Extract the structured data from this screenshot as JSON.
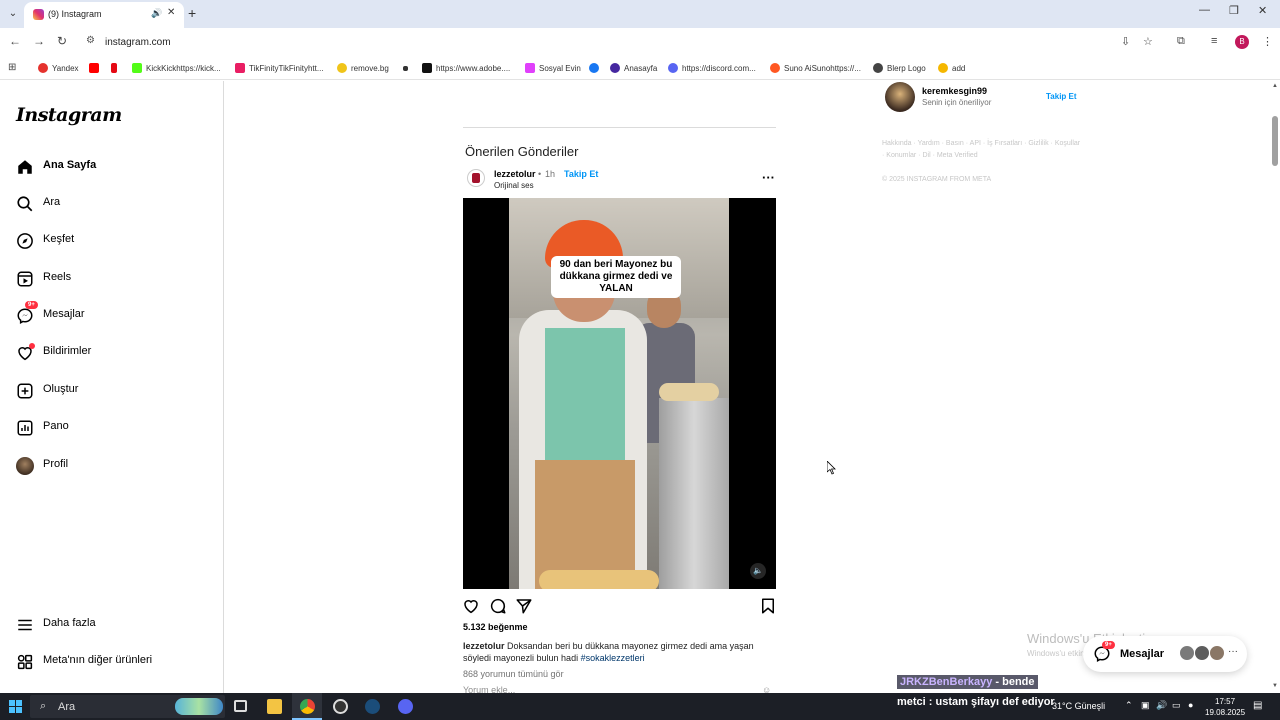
{
  "browser": {
    "tab_title": "(9) Instagram",
    "url": "instagram.com",
    "profile_letter": "B",
    "bookmarks": [
      {
        "label": "Yandex",
        "color": "#e5322d"
      },
      {
        "label": "",
        "color": "#ff0000"
      },
      {
        "label": "",
        "color": "#e50914"
      },
      {
        "label": "KickKickhttps://kick...",
        "color": "#53fc18"
      },
      {
        "label": "TikFinityTikFinityhtt...",
        "color": "#e91e63"
      },
      {
        "label": "remove.bg",
        "color": "#f0c419"
      },
      {
        "label": "",
        "color": "#333333"
      },
      {
        "label": "https://www.adobe....",
        "color": "#111111"
      },
      {
        "label": "Sosyal Evin",
        "color": "#e040fb"
      },
      {
        "label": "",
        "color": "#1877f2"
      },
      {
        "label": "Anasayfa",
        "color": "#4527a0"
      },
      {
        "label": "https://discord.com...",
        "color": "#5865f2"
      },
      {
        "label": "Suno AiSunohttps://...",
        "color": "#ff5722"
      },
      {
        "label": "Blerp Logo",
        "color": "#444444"
      },
      {
        "label": "add",
        "color": "#f5b700"
      }
    ]
  },
  "sidebar": {
    "logo": "Instagram",
    "items": [
      {
        "label": "Ana Sayfa",
        "icon": "home-icon"
      },
      {
        "label": "Ara",
        "icon": "search-icon"
      },
      {
        "label": "Keşfet",
        "icon": "compass-icon"
      },
      {
        "label": "Reels",
        "icon": "reels-icon"
      },
      {
        "label": "Mesajlar",
        "icon": "messenger-icon",
        "badge": "9+"
      },
      {
        "label": "Bildirimler",
        "icon": "heart-icon"
      },
      {
        "label": "Oluştur",
        "icon": "plus-square-icon"
      },
      {
        "label": "Pano",
        "icon": "dashboard-icon"
      },
      {
        "label": "Profil",
        "icon": "profile-avatar"
      }
    ],
    "more": "Daha fazla",
    "meta": "Meta'nın diğer ürünleri"
  },
  "feed": {
    "section_title": "Önerilen Gönderiler",
    "post": {
      "username": "lezzetolur",
      "separator": "•",
      "time": "1h",
      "follow": "Takip Et",
      "audio": "Orijinal ses",
      "overlay_text": "90 dan beri Mayonez bu dükkana girmez dedi ve YALAN",
      "likes": "5.132 beğenme",
      "caption_user": "lezzetolur",
      "caption": "Doksandan beri bu dükkana mayonez girmez dedi ama yaşan söyledi mayonezli bulun hadi",
      "hashtag": "#sokaklezzetleri",
      "view_comments": "868 yorumun tümünü gör",
      "add_comment": "Yorum ekle..."
    }
  },
  "right": {
    "suggestion": {
      "username": "keremkesgin99",
      "subtitle": "Senin için öneriliyor",
      "follow": "Takip Et"
    },
    "footer": "Hakkında · Yardım · Basın · API · İş Fırsatları · Gizlilik · Koşullar · Konumlar · Dil · Meta Verified",
    "copyright": "© 2025 INSTAGRAM FROM META"
  },
  "overlay": {
    "activate_title": "Windows'u Etkinleştir",
    "activate_sub": "Windows'u etkinleştirmek için Ayarlar'a gidin.",
    "messages_label": "Mesajlar",
    "messages_badge": "9+",
    "stream_line1_user": "JRKZBenBerkayy",
    "stream_line1_text": " - bende",
    "stream_line2": "metci : ustam şifayı def ediyor"
  },
  "taskbar": {
    "search": "Ara",
    "weather": "31°C  Güneşli",
    "time": "17:57",
    "date": "19.08.2025"
  },
  "colors": {
    "accent": "#0095f6",
    "badge": "#ff3040"
  }
}
